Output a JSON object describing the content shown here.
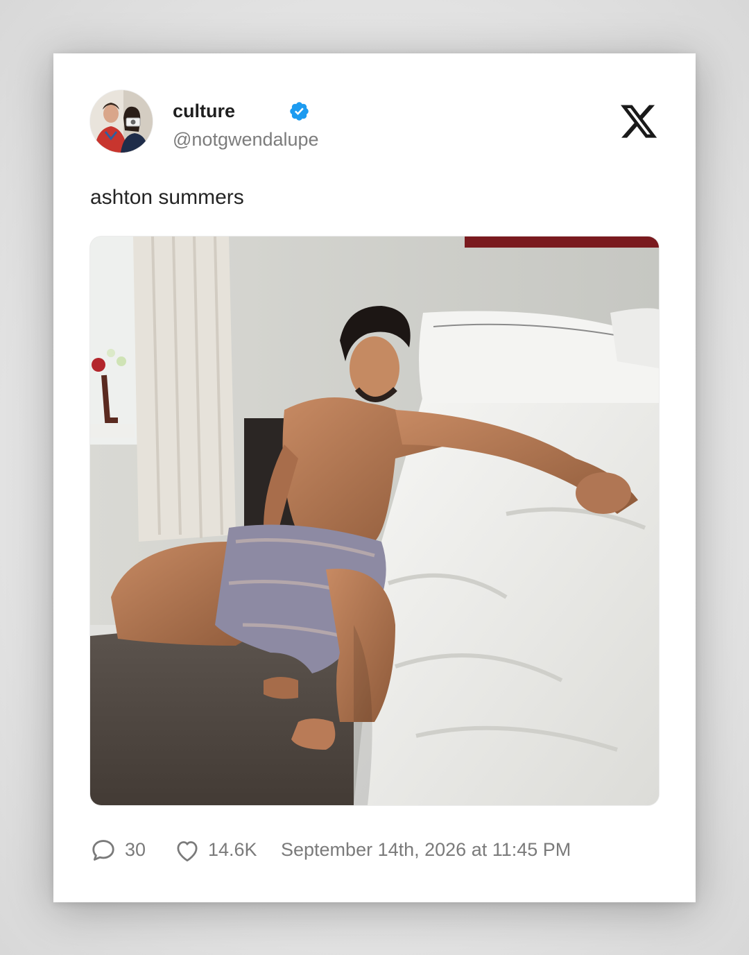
{
  "tweet": {
    "display_name": "culture",
    "handle": "@notgwendalupe",
    "verified": true,
    "text": "ashton summers",
    "media_alt": "Shirtless man with curly dark hair in patterned shorts crouching beside an unmade white bed in a bright bedroom",
    "avatar_alt": "Two people taking a mirror selfie",
    "platform_icon": "x-logo-icon"
  },
  "footer": {
    "comment_count": "30",
    "like_count": "14.6K",
    "timestamp": "September 14th, 2026 at 11:45 PM"
  },
  "colors": {
    "verified_blue": "#1d9bf0",
    "meta_gray": "#7a7a7a",
    "text_dark": "#242424"
  }
}
